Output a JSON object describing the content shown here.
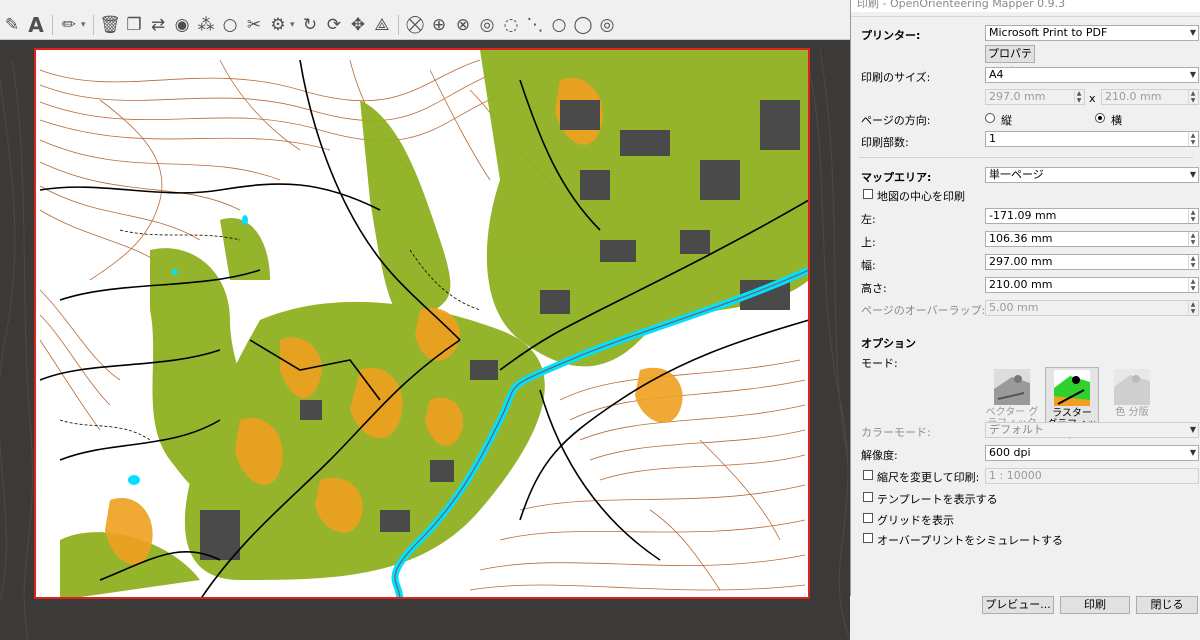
{
  "dialog": {
    "title": "印刷 - OpenOrienteering Mapper 0.9.3",
    "printer_label": "プリンター:",
    "printer_value": "Microsoft Print to PDF",
    "properties_button": "プロパティ",
    "page_size_label": "印刷のサイズ:",
    "page_size_value": "A4",
    "page_width": "297.0 mm",
    "times": "x",
    "page_height": "210.0 mm",
    "orientation_label": "ページの方向:",
    "orientation_portrait": "縦",
    "orientation_landscape": "横",
    "copies_label": "印刷部数:",
    "copies_value": "1",
    "map_area_label": "マップエリア:",
    "map_area_value": "単一ページ",
    "center_label": "地図の中心を印刷",
    "left_label": "左:",
    "left_value": "-171.09 mm",
    "top_label": "上:",
    "top_value": "106.36 mm",
    "width_label": "幅:",
    "width_value": "297.00 mm",
    "height_label": "高さ:",
    "height_value": "210.00 mm",
    "overlap_label": "ページのオーバーラップ:",
    "overlap_value": "5.00 mm",
    "options_label": "オプション",
    "mode_label": "モード:",
    "mode_vector": "ベクター グラフィック",
    "mode_raster": "ラスター グラフィック",
    "mode_separations": "色 分版",
    "color_mode_label": "カラーモード:",
    "color_mode_value": "デフォルト",
    "resolution_label": "解像度:",
    "resolution_value": "600 dpi",
    "scale_label": "縮尺を変更して印刷:",
    "scale_value": "1 : 10000",
    "templates_label": "テンプレートを表示する",
    "grid_label": "グリッドを表示",
    "overprint_label": "オーバープリントをシミュレートする",
    "preview_button": "プレビュー...",
    "print_button": "印刷",
    "close_button": "閉じる"
  },
  "colors": {
    "print_frame": "#e0201a",
    "paper": "#ffffff",
    "contour": "#b0602a",
    "vegetation": "#8fb021",
    "rough_open": "#f0a020",
    "building": "#4a4a4a",
    "water": "#00e0ff",
    "road": "#000000",
    "outside_shade": "#3a3a3a"
  }
}
